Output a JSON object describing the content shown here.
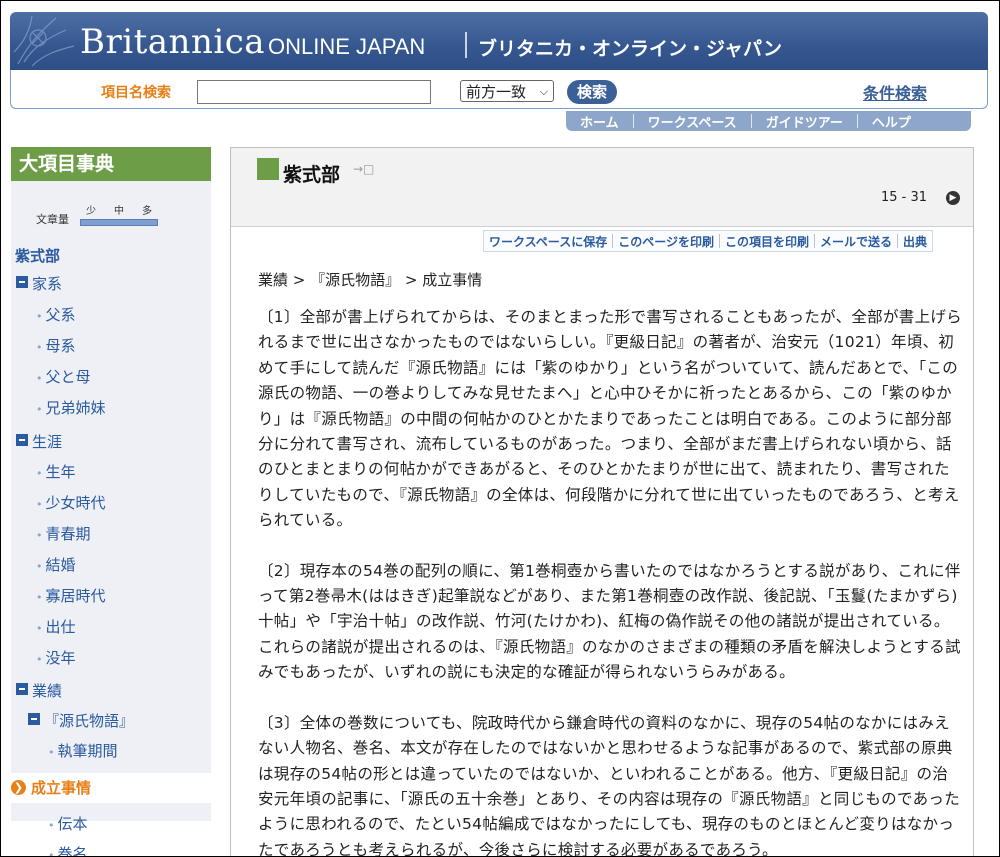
{
  "header": {
    "brand_main": "Britannica",
    "brand_sub": "ONLINE JAPAN",
    "brand_ja": "ブリタニカ・オンライン・ジャパン"
  },
  "search": {
    "label": "項目名検索",
    "value": "",
    "match_mode": "前方一致",
    "button": "検索",
    "advanced_link": "条件検索"
  },
  "nav": [
    "ホーム",
    "ワークスペース",
    "ガイドツアー",
    "ヘルプ"
  ],
  "sidebar": {
    "title": "大項目事典",
    "text_length_label": "文章量",
    "text_length_marks": [
      "少",
      "中",
      "多"
    ],
    "article": "紫式部",
    "sections": [
      {
        "label": "家系",
        "items": [
          "父系",
          "母系",
          "父と母",
          "兄弟姉妹"
        ]
      },
      {
        "label": "生涯",
        "items": [
          "生年",
          "少女時代",
          "青春期",
          "結婚",
          "寡居時代",
          "出仕",
          "没年"
        ]
      },
      {
        "label": "業績",
        "sub": "『源氏物語』",
        "items": [
          "執筆期間"
        ]
      }
    ],
    "current": "成立事情",
    "after_items": [
      "伝本",
      "巻名"
    ]
  },
  "article": {
    "title": "紫式部",
    "page_range": "15 - 31",
    "tools": [
      "ワークスペースに保存",
      "このページを印刷",
      "この項目を印刷",
      "メールで送る",
      "出典"
    ],
    "breadcrumb": "業績 > 『源氏物語』 > 成立事情",
    "paragraphs": [
      "〔1〕全部が書上げられてからは、そのまとまった形で書写されることもあったが、全部が書上げられるまで世に出さなかったものではないらしい。『更級日記』の著者が、治安元（1021）年頃、初めて手にして読んだ『源氏物語』には「紫のゆかり」という名がついていて、読んだあとで、「この源氏の物語、一の巻よりしてみな見せたまへ」と心中ひそかに祈ったとあるから、この「紫のゆかり」は『源氏物語』の中間の何帖かのひとかたまりであったことは明白である。このように部分部分に分れて書写され、流布しているものがあった。つまり、全部がまだ書上げられない頃から、話のひとまとまりの何帖かができあがると、そのひとかたまりが世に出て、読まれたり、書写されたりしていたもので、『源氏物語』の全体は、何段階かに分れて世に出ていったものであろう、と考えられている。",
      "〔2〕現存本の54巻の配列の順に、第1巻桐壺から書いたのではなかろうとする説があり、これに伴って第2巻帚木(ははきぎ)起筆説などがあり、また第1巻桐壺の改作説、後記説、「玉鬘(たまかずら)十帖」や「宇治十帖」の改作説、竹河(たけかわ)、紅梅の偽作説その他の諸説が提出されている。これらの諸説が提出されるのは、『源氏物語』のなかのさまざまの種類の矛盾を解決しようとする試みでもあったが、いずれの説にも決定的な確証が得られないうらみがある。",
      "〔3〕全体の巻数についても、院政時代から鎌倉時代の資料のなかに、現存の54帖のなかにはみえない人物名、巻名、本文が存在したのではないかと思わせるような記事があるので、紫式部の原典は現存の54帖の形とは違っていたのではないか、といわれることがある。他方、『更級日記』の治安元年頃の記事に、「源氏の五十余巻」とあり、その内容は現存の『源氏物語』と同じものであったように思われるので、たとい54帖編成ではなかったにしても、現存のものとほとんど変りはなかったであろうとも考えられるが、今後さらに検討する必要があるであろう。"
    ]
  },
  "colors": {
    "banner": "#35578f",
    "accent_orange": "#e8801a",
    "sidebar_green": "#6e9d48",
    "link_blue": "#2a5aa0"
  }
}
